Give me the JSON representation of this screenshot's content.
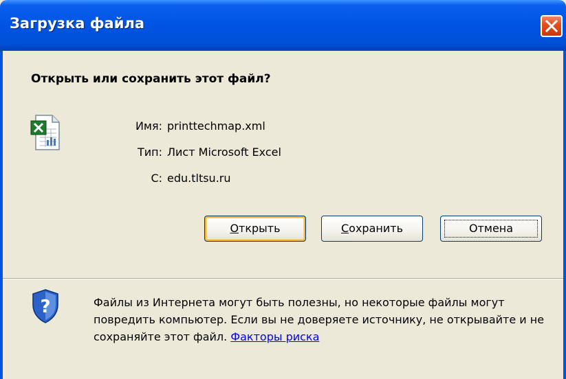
{
  "window": {
    "title": "Загрузка файла",
    "close_label": "×"
  },
  "dialog": {
    "question": "Открыть или сохранить этот файл?",
    "file_icon": "excel-file-icon",
    "name_label": "Имя:",
    "name_value": "printtechmap.xml",
    "type_label": "Тип:",
    "type_value": "Лист Microsoft Excel",
    "from_label": "С:",
    "from_value": "edu.tltsu.ru"
  },
  "buttons": {
    "open": {
      "accel": "О",
      "rest": "ткрыть"
    },
    "save": {
      "accel": "С",
      "rest": "охранить"
    },
    "cancel": "Отмена"
  },
  "warning": {
    "icon": "shield-question-icon",
    "text": "Файлы из Интернета могут быть полезны, но некоторые файлы могут повредить компьютер. Если вы не доверяете источнику, не открывайте и не сохраняйте этот файл.",
    "link": "Факторы риска"
  },
  "colors": {
    "titlebar": "#0054e3",
    "face": "#ece9d8",
    "close": "#e3501d",
    "link": "#0000ff"
  }
}
